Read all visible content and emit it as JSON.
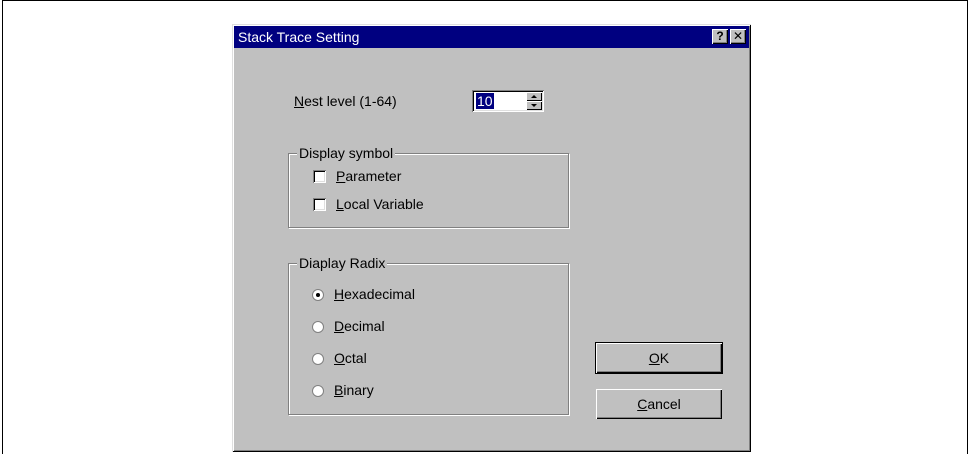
{
  "dialog": {
    "title": "Stack Trace Setting",
    "help_button": "?",
    "close_button": "✕"
  },
  "nest_level": {
    "label_u": "N",
    "label_rest": "est level (1-64)",
    "value": "10"
  },
  "display_symbol": {
    "title": "Display symbol",
    "options": [
      {
        "u": "P",
        "rest": "arameter",
        "checked": false
      },
      {
        "u": "L",
        "rest": "ocal Variable",
        "checked": false
      }
    ]
  },
  "display_radix": {
    "title": "Diaplay Radix",
    "options": [
      {
        "u": "H",
        "rest": "exadecimal",
        "selected": true
      },
      {
        "u": "D",
        "rest": "ecimal",
        "selected": false
      },
      {
        "u": "O",
        "rest": "ctal",
        "selected": false
      },
      {
        "u": "B",
        "rest": "inary",
        "selected": false
      }
    ]
  },
  "buttons": {
    "ok_u": "O",
    "ok_rest": "K",
    "cancel_u": "C",
    "cancel_rest": "ancel"
  }
}
